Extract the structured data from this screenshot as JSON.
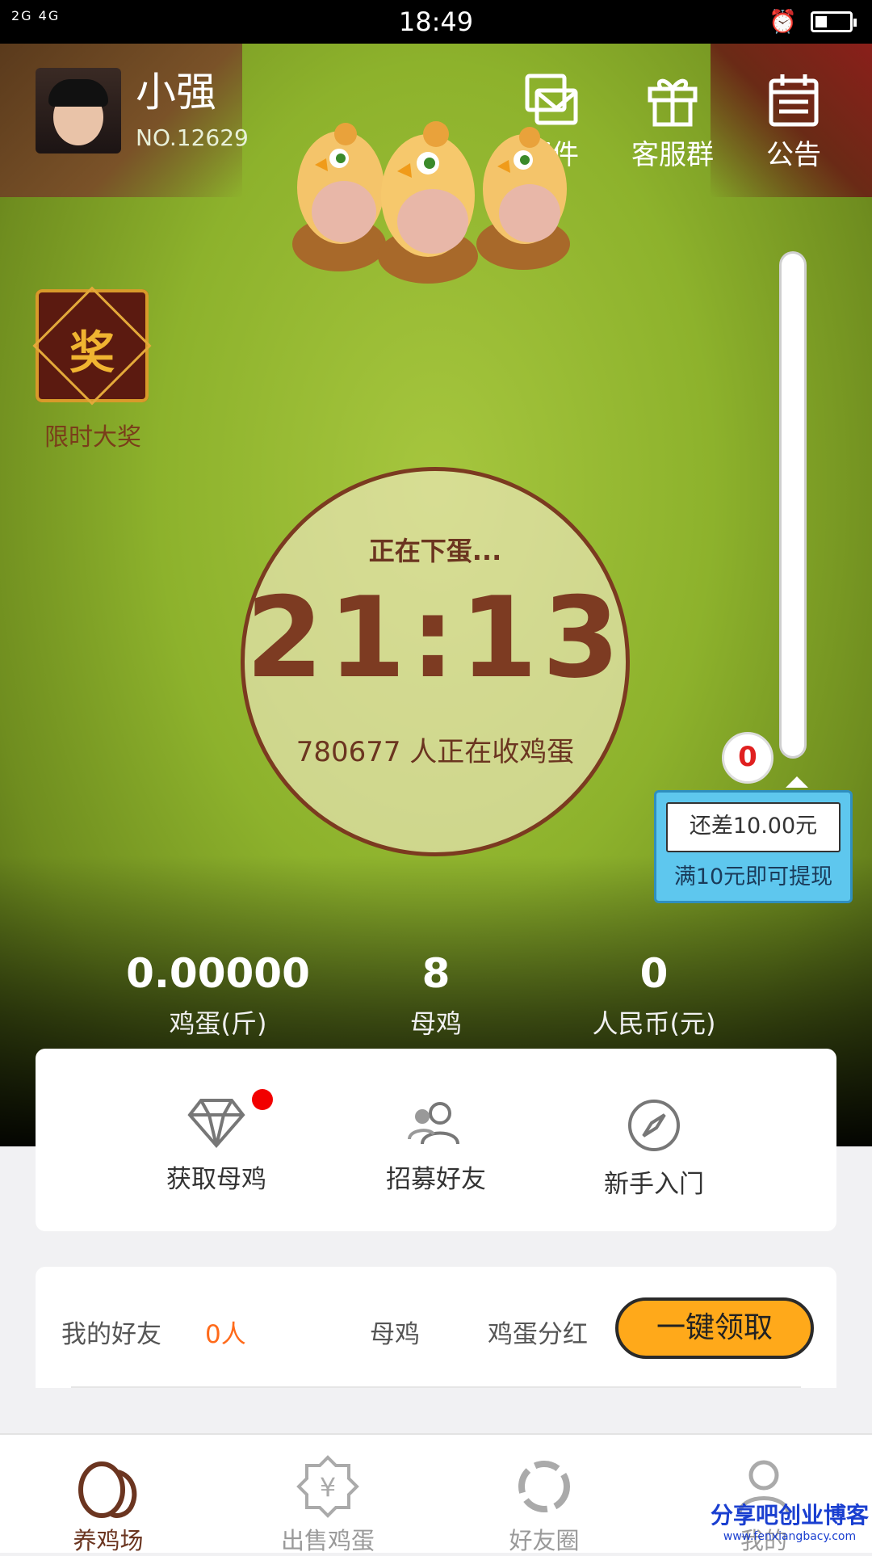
{
  "status_bar": {
    "signal_label": "2G 4G",
    "time": "18:49",
    "battery_level": 0.35
  },
  "user": {
    "name": "小强",
    "number": "NO.12629"
  },
  "top_actions": [
    {
      "icon": "mail-icon",
      "label": "邮件"
    },
    {
      "icon": "gift-icon",
      "label": "客服群"
    },
    {
      "icon": "calendar-icon",
      "label": "公告"
    }
  ],
  "prize": {
    "badge_char": "奖",
    "label": "限时大奖"
  },
  "timer": {
    "status": "正在下蛋...",
    "value": "21:13",
    "collectors": "780677 人正在收鸡蛋"
  },
  "withdraw": {
    "progress": 0,
    "progress_label": "0",
    "remaining": "还差10.00元",
    "hint": "满10元即可提现"
  },
  "stats": [
    {
      "value": "0.00000",
      "label": "鸡蛋(斤)"
    },
    {
      "value": "8",
      "label": "母鸡"
    },
    {
      "value": "0",
      "label": "人民币(元)"
    }
  ],
  "actions": [
    {
      "icon": "diamond-icon",
      "label": "获取母鸡",
      "has_dot": true
    },
    {
      "icon": "recruit-friends-icon",
      "label": "招募好友",
      "has_dot": false
    },
    {
      "icon": "compass-icon",
      "label": "新手入门",
      "has_dot": false
    }
  ],
  "friends": {
    "label": "我的好友",
    "count": "0人",
    "hens_label": "母鸡",
    "dividend_label": "鸡蛋分红",
    "claim_button": "一键领取"
  },
  "tabs": [
    {
      "icon": "eggs-icon",
      "label": "养鸡场",
      "active": true
    },
    {
      "icon": "sell-eggs-icon",
      "label": "出售鸡蛋",
      "active": false
    },
    {
      "icon": "friends-circle-icon",
      "label": "好友圈",
      "active": false
    },
    {
      "icon": "profile-icon",
      "label": "我的",
      "active": false
    }
  ],
  "watermark": {
    "title": "分享吧创业博客",
    "url": "www.fenxiangbacy.com"
  },
  "colors": {
    "accent_brown": "#7d3b22",
    "claim_orange": "#ffa91a",
    "badge_red": "#f20000",
    "tip_blue": "#5ec7ee"
  }
}
